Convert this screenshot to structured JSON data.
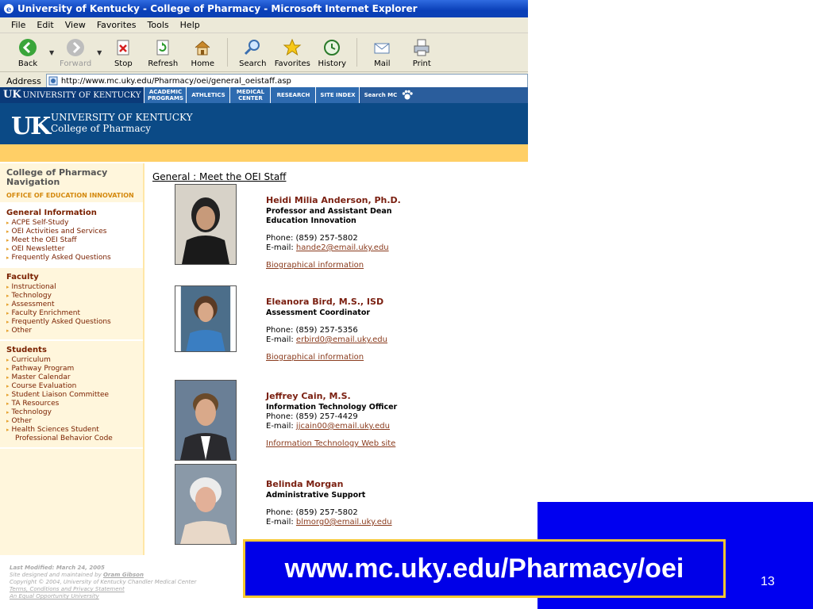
{
  "window": {
    "title": "University of Kentucky - College of Pharmacy - Microsoft Internet Explorer"
  },
  "menu": [
    "File",
    "Edit",
    "View",
    "Favorites",
    "Tools",
    "Help"
  ],
  "toolbar": {
    "back": "Back",
    "forward": "Forward",
    "stop": "Stop",
    "refresh": "Refresh",
    "home": "Home",
    "search": "Search",
    "favorites": "Favorites",
    "history": "History",
    "mail": "Mail",
    "print": "Print"
  },
  "address": {
    "label": "Address",
    "url": "http://www.mc.uky.edu/Pharmacy/oei/general_oeistaff.asp"
  },
  "uk_nav": {
    "logo_uk": "UK",
    "logo_text": "UNIVERSITY OF KENTUCKY",
    "items": [
      "ACADEMIC PROGRAMS",
      "ATHLETICS",
      "MEDICAL CENTER",
      "RESEARCH",
      "SITE INDEX",
      "Search MC"
    ]
  },
  "header": {
    "logo": "UK",
    "line1": "UNIVERSITY OF KENTUCKY",
    "line2": "College of Pharmacy"
  },
  "sidebar": {
    "title": "College of Pharmacy Navigation",
    "subtitle": "OFFICE OF EDUCATION INNOVATION",
    "general": {
      "title": "General Information",
      "links": [
        "ACPE Self-Study",
        "OEI Activities and Services",
        "Meet the OEI Staff",
        "OEI Newsletter",
        "Frequently Asked Questions"
      ]
    },
    "faculty": {
      "title": "Faculty",
      "links": [
        "Instructional",
        "Technology",
        "Assessment",
        "Faculty Enrichment",
        "Frequently Asked Questions",
        "Other"
      ]
    },
    "students": {
      "title": "Students",
      "links": [
        "Curriculum",
        "Pathway Program",
        "Master Calendar",
        "Course Evaluation",
        "Student Liaison Committee",
        "TA Resources",
        "Technology",
        "Other"
      ],
      "last_link_1": "Health Sciences Student",
      "last_link_2": "Professional Behavior Code"
    }
  },
  "footer": {
    "line1": "Last Modified: March 24, 2005",
    "line2": "Site designed and maintained by",
    "designer": "Oram Gibson",
    "line3": "Copyright © 2004, University of Kentucky Chandler Medical Center",
    "line4": "Terms, Conditions and Privacy Statement",
    "line5": "An Equal Opportunity University"
  },
  "main": {
    "breadcrumb": "General : Meet the OEI Staff",
    "staff": [
      {
        "name": "Heidi Milia Anderson, Ph.D.",
        "title1": "Professor and Assistant Dean",
        "title2": "Education Innovation",
        "phone": "Phone: (859) 257-5802",
        "email_label": "E-mail:",
        "email": "hande2@email.uky.edu",
        "link": "Biographical information"
      },
      {
        "name": "Eleanora Bird, M.S., ISD",
        "title1": "Assessment Coordinator",
        "phone": "Phone: (859) 257-5356",
        "email_label": "E-mail:",
        "email": "erbird0@email.uky.edu",
        "link": "Biographical information"
      },
      {
        "name": "Jeffrey Cain, M.S.",
        "title1": "Information Technology Officer",
        "phone": "Phone: (859) 257-4429",
        "email_label": "E-mail:",
        "email": "jjcain00@email.uky.edu",
        "link": "Information Technology Web site"
      },
      {
        "name": "Belinda Morgan",
        "title1": "Administrative Support",
        "phone": "Phone: (859) 257-5802",
        "email_label": "E-mail:",
        "email": "blmorg0@email.uky.edu"
      }
    ]
  },
  "slide": {
    "url": "www.mc.uky.edu/Pharmacy/oei",
    "page_number": "13"
  },
  "colors": {
    "slide_blue": "#0000f0",
    "gold_border": "#f8c830",
    "uk_blue": "#0b4a86"
  }
}
